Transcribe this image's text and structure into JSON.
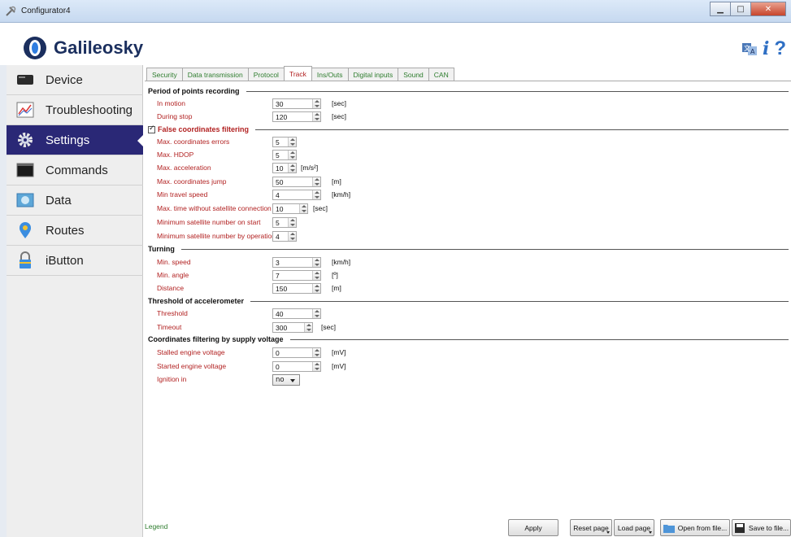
{
  "window": {
    "title": "Configurator4",
    "controls": [
      "minimize",
      "maximize",
      "close"
    ]
  },
  "header": {
    "brand": "Galileosky",
    "icons": [
      "language-icon",
      "info-icon",
      "help-icon"
    ],
    "info_glyph": "i",
    "help_glyph": "?"
  },
  "sidebar": {
    "items": [
      {
        "label": "Device",
        "icon": "device-icon",
        "active": false
      },
      {
        "label": "Troubleshooting",
        "icon": "troubleshooting-icon",
        "active": false
      },
      {
        "label": "Settings",
        "icon": "gear-icon",
        "active": true
      },
      {
        "label": "Commands",
        "icon": "terminal-icon",
        "active": false
      },
      {
        "label": "Data",
        "icon": "data-icon",
        "active": false
      },
      {
        "label": "Routes",
        "icon": "map-pin-icon",
        "active": false
      },
      {
        "label": "iButton",
        "icon": "lock-icon",
        "active": false
      }
    ]
  },
  "tabs": [
    {
      "label": "Security"
    },
    {
      "label": "Data transmission"
    },
    {
      "label": "Protocol"
    },
    {
      "label": "Track",
      "active": true
    },
    {
      "label": "Ins/Outs"
    },
    {
      "label": "Digital inputs"
    },
    {
      "label": "Sound"
    },
    {
      "label": "CAN"
    }
  ],
  "sections": {
    "period": {
      "title": "Period of points recording",
      "rows": [
        {
          "label": "In motion",
          "value": "30",
          "unit": "[sec]"
        },
        {
          "label": "During stop",
          "value": "120",
          "unit": "[sec]"
        }
      ]
    },
    "false_filter": {
      "title": "False coordinates filtering",
      "checked": true,
      "rows": [
        {
          "label": "Max. coordinates errors",
          "value": "5",
          "unit": ""
        },
        {
          "label": "Max. HDOP",
          "value": "5",
          "unit": ""
        },
        {
          "label": "Max. acceleration",
          "value": "10",
          "unit": "[m/s²]"
        },
        {
          "label": "Max. coordinates jump",
          "value": "50",
          "unit": "[m]"
        },
        {
          "label": "Min travel speed",
          "value": "4",
          "unit": "[km/h]"
        },
        {
          "label": "Max. time without satellite connection",
          "value": "10",
          "unit": "[sec]"
        },
        {
          "label": "Minimum satellite number on start",
          "value": "5",
          "unit": ""
        },
        {
          "label": "Minimum satellite number by operation",
          "value": "4",
          "unit": ""
        }
      ]
    },
    "turning": {
      "title": "Turning",
      "rows": [
        {
          "label": "Min. speed",
          "value": "3",
          "unit": "[km/h]"
        },
        {
          "label": "Min. angle",
          "value": "7",
          "unit": "[º]"
        },
        {
          "label": "Distance",
          "value": "150",
          "unit": "[m]"
        }
      ]
    },
    "accel": {
      "title": "Threshold of accelerometer",
      "rows": [
        {
          "label": "Threshold",
          "value": "40",
          "unit": ""
        },
        {
          "label": "Timeout",
          "value": "300",
          "unit": "[sec]"
        }
      ]
    },
    "voltage": {
      "title": "Coordinates filtering by supply voltage",
      "rows": [
        {
          "label": "Stalled engine voltage",
          "value": "0",
          "unit": "[mV]"
        },
        {
          "label": "Started engine voltage",
          "value": "0",
          "unit": "[mV]"
        }
      ],
      "ignition": {
        "label": "Ignition in",
        "value": "no"
      }
    }
  },
  "footer": {
    "legend": "Legend",
    "apply": "Apply",
    "reset_page": "Reset page",
    "load_page": "Load page",
    "open_from_file": "Open from file...",
    "save_to_file": "Save to file..."
  },
  "colors": {
    "accent": "#2a2876",
    "label_red": "#b22222",
    "tab_green": "#2e7d2e"
  }
}
